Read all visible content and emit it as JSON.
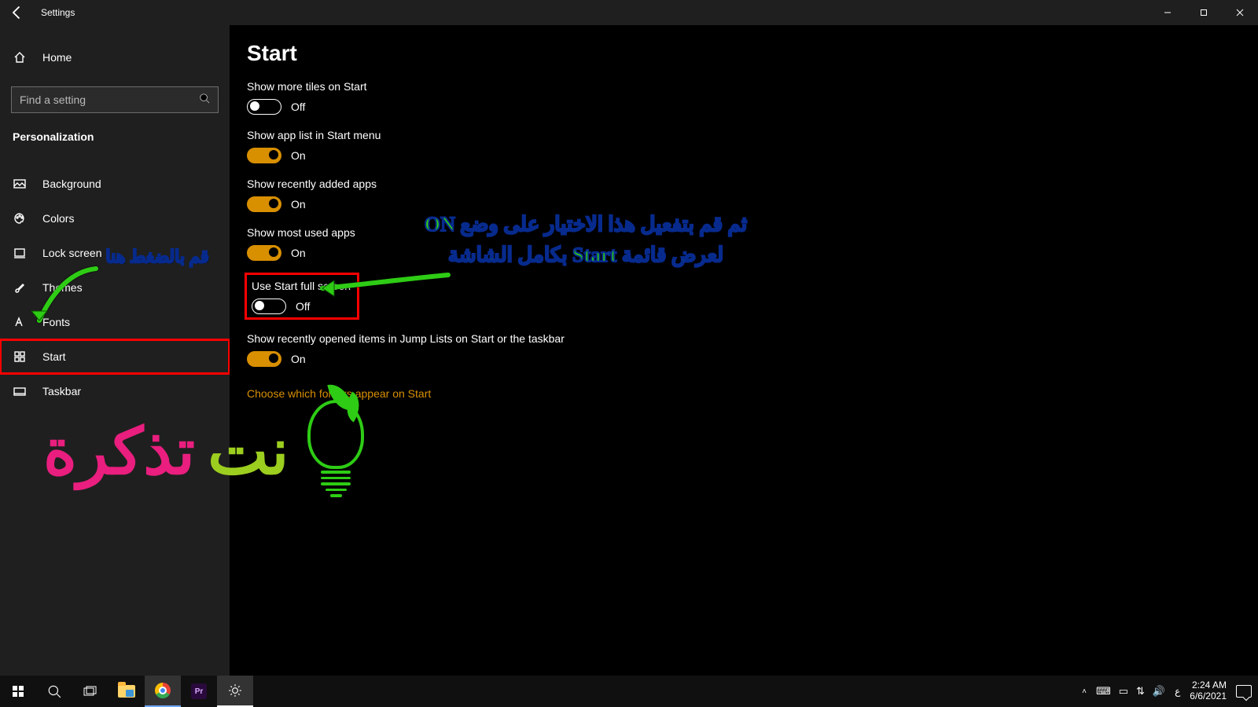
{
  "titlebar": {
    "app_name": "Settings"
  },
  "sidebar": {
    "home_label": "Home",
    "search_placeholder": "Find a setting",
    "section_title": "Personalization",
    "items": [
      {
        "label": "Background"
      },
      {
        "label": "Colors"
      },
      {
        "label": "Lock screen"
      },
      {
        "label": "Themes"
      },
      {
        "label": "Fonts"
      },
      {
        "label": "Start"
      },
      {
        "label": "Taskbar"
      }
    ]
  },
  "content": {
    "page_title": "Start",
    "settings": [
      {
        "label": "Show more tiles on Start",
        "state": "off",
        "state_text": "Off"
      },
      {
        "label": "Show app list in Start menu",
        "state": "on",
        "state_text": "On"
      },
      {
        "label": "Show recently added apps",
        "state": "on",
        "state_text": "On"
      },
      {
        "label": "Show most used apps",
        "state": "on",
        "state_text": "On"
      },
      {
        "label": "Use Start full screen",
        "state": "off",
        "state_text": "Off"
      },
      {
        "label": "Show recently opened items in Jump Lists on Start or the taskbar",
        "state": "on",
        "state_text": "On"
      }
    ],
    "link": "Choose which folders appear on Start"
  },
  "annotations": {
    "sidebar_hint": "قم بالضغط هنا",
    "main_hint_line1": "ثم قم بتفعيل هذا الاختيار على وضع ON",
    "main_hint_line2": "لعرض قائمة Start بكامل الشاشة",
    "logo_word1": "نت",
    "logo_word2": "تذكرة"
  },
  "taskbar": {
    "premiere_label": "Pr",
    "lang": "ع",
    "time": "2:24 AM",
    "date": "6/6/2021"
  }
}
